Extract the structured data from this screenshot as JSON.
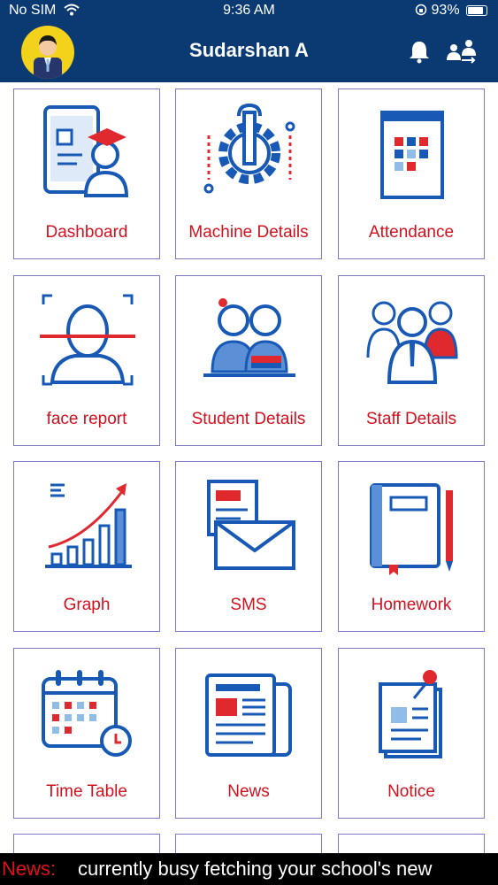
{
  "status": {
    "carrier": "No SIM",
    "time": "9:36 AM",
    "battery": "93%"
  },
  "header": {
    "title": "Sudarshan A"
  },
  "tiles": [
    {
      "label": "Dashboard"
    },
    {
      "label": "Machine Details"
    },
    {
      "label": "Attendance"
    },
    {
      "label": "face report"
    },
    {
      "label": "Student Details"
    },
    {
      "label": "Staff Details"
    },
    {
      "label": "Graph"
    },
    {
      "label": "SMS"
    },
    {
      "label": "Homework"
    },
    {
      "label": "Time Table"
    },
    {
      "label": "News"
    },
    {
      "label": "Notice"
    }
  ],
  "ticker": {
    "label": "News:",
    "text": "currently busy fetching your school's new"
  },
  "colors": {
    "header": "#0b3a73",
    "label": "#d0111f",
    "ticker_label": "#e0101c",
    "icon_blue": "#1859b6",
    "icon_red": "#e0282f"
  }
}
